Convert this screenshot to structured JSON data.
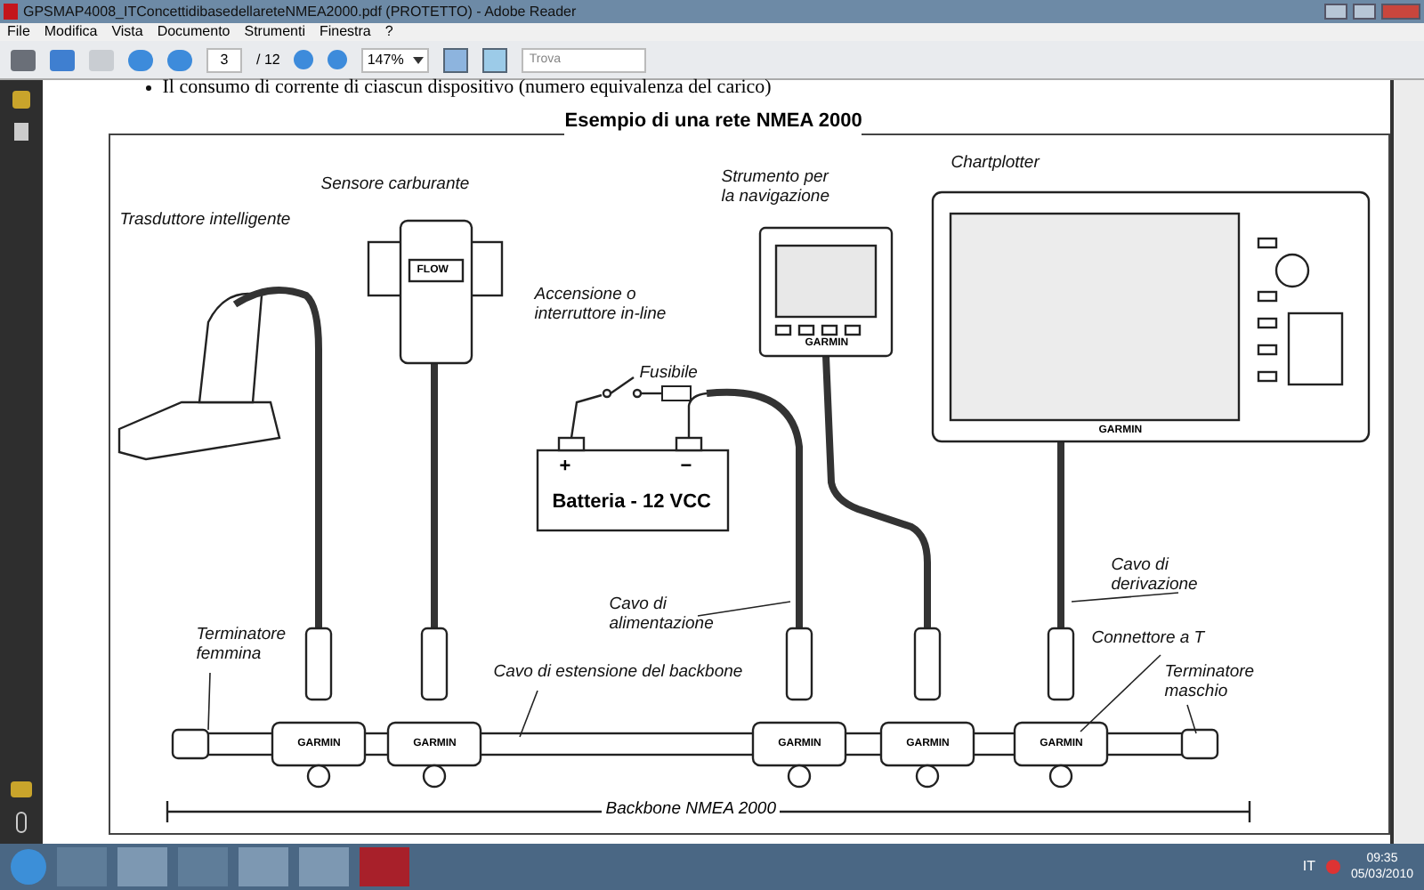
{
  "window": {
    "title": "GPSMAP4008_ITConcettidibasedellareteNMEA2000.pdf (PROTETTO) - Adobe Reader"
  },
  "menu": [
    "File",
    "Modifica",
    "Vista",
    "Documento",
    "Strumenti",
    "Finestra",
    "?"
  ],
  "toolbar": {
    "page": "3",
    "page_total": "/ 12",
    "zoom": "147%",
    "search": {
      "placeholder": "Trova"
    }
  },
  "document": {
    "bullet_text": "Il consumo di corrente di ciascun dispositivo (numero equivalenza del carico)",
    "figure_title": "Esempio di una rete NMEA 2000",
    "labels": [
      "Trasduttore intelligente",
      "Sensore carburante",
      "Strumento per\nla navigazione",
      "Chartplotter",
      "Accensione o\ninterruttore in-line",
      "Fusibile",
      "Cavo di\nalimentazione",
      "Cavo di\nderivazione",
      "Terminatore\nfemmina",
      "Cavo di estensione del backbone",
      "Connettore a T",
      "Terminatore\nmaschio"
    ],
    "backbone_label": "Backbone NMEA 2000",
    "battery": {
      "label": "Batteria - 12 VCC",
      "plus": "+",
      "minus": "−"
    },
    "sensor_text": "FLOW",
    "chartplotter_brand": "GARMIN",
    "instrument_brand": "GARMIN",
    "connector_brands": [
      "GARMIN",
      "GARMIN",
      "GARMIN",
      "GARMIN",
      "GARMIN"
    ]
  },
  "taskbar": {
    "language": "IT",
    "time": "09:35",
    "date": "05/03/2010"
  }
}
